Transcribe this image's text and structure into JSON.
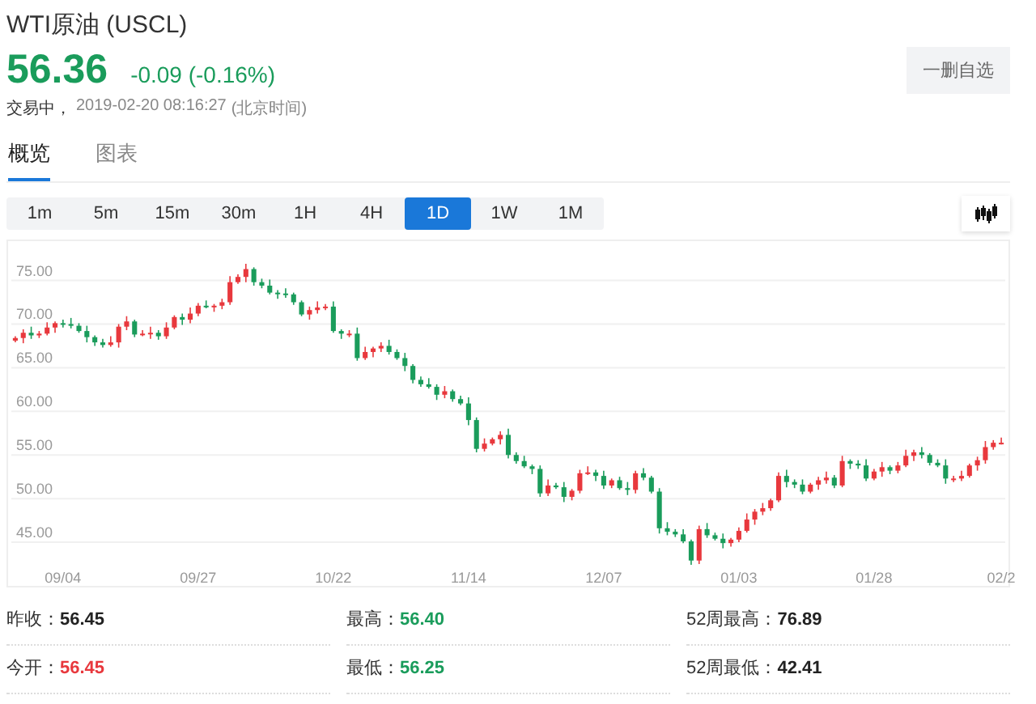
{
  "header": {
    "title": "WTI原油 (USCL)",
    "price": "56.36",
    "change": "-0.09 (-0.16%)",
    "status": "交易中，",
    "time": "2019-02-20 08:16:27",
    "timezone": "(北京时间)",
    "watch_button": "一删自选"
  },
  "tabs": [
    {
      "label": "概览",
      "selected": true
    },
    {
      "label": "图表",
      "selected": false
    }
  ],
  "periods": [
    {
      "label": "1m",
      "selected": false
    },
    {
      "label": "5m",
      "selected": false
    },
    {
      "label": "15m",
      "selected": false
    },
    {
      "label": "30m",
      "selected": false
    },
    {
      "label": "1H",
      "selected": false
    },
    {
      "label": "4H",
      "selected": false
    },
    {
      "label": "1D",
      "selected": true
    },
    {
      "label": "1W",
      "selected": false
    },
    {
      "label": "1M",
      "selected": false
    }
  ],
  "chart": {
    "chart_data": {
      "type": "candlestick",
      "categories": [
        null,
        null,
        null,
        null,
        null,
        null,
        "09/04",
        null,
        null,
        null,
        null,
        null,
        null,
        null,
        null,
        null,
        null,
        null,
        null,
        null,
        null,
        null,
        null,
        "09/27",
        null,
        null,
        null,
        null,
        null,
        null,
        null,
        null,
        null,
        null,
        null,
        null,
        null,
        null,
        null,
        null,
        "10/22",
        null,
        null,
        null,
        null,
        null,
        null,
        null,
        null,
        null,
        null,
        null,
        null,
        null,
        null,
        null,
        null,
        "11/14",
        null,
        null,
        null,
        null,
        null,
        null,
        null,
        null,
        null,
        null,
        null,
        null,
        null,
        null,
        null,
        null,
        "12/07",
        null,
        null,
        null,
        null,
        null,
        null,
        null,
        null,
        null,
        null,
        null,
        null,
        null,
        null,
        null,
        null,
        "01/03",
        null,
        null,
        null,
        null,
        null,
        null,
        null,
        null,
        null,
        null,
        null,
        null,
        null,
        null,
        null,
        null,
        "01/28",
        null,
        null,
        null,
        null,
        null,
        null,
        null,
        null,
        null,
        null,
        null,
        null,
        null,
        null,
        null,
        "02/2"
      ],
      "ohlc": [
        [
          68.1,
          68.6,
          67.9,
          68.4
        ],
        [
          68.4,
          69.4,
          67.8,
          69.0
        ],
        [
          69.0,
          69.7,
          68.3,
          68.7
        ],
        [
          68.7,
          69.2,
          68.4,
          68.9
        ],
        [
          68.9,
          70.2,
          68.7,
          69.6
        ],
        [
          69.6,
          70.3,
          69.0,
          70.1
        ],
        [
          70.1,
          70.5,
          69.6,
          70.0
        ],
        [
          70.0,
          70.7,
          69.5,
          69.8
        ],
        [
          69.8,
          70.1,
          69.0,
          69.2
        ],
        [
          69.2,
          69.8,
          67.9,
          68.5
        ],
        [
          68.5,
          68.7,
          67.5,
          67.9
        ],
        [
          67.9,
          68.3,
          67.3,
          67.6
        ],
        [
          67.6,
          68.6,
          67.4,
          67.9
        ],
        [
          67.9,
          70.0,
          67.3,
          69.7
        ],
        [
          69.7,
          70.9,
          69.3,
          70.3
        ],
        [
          70.3,
          70.5,
          68.5,
          68.8
        ],
        [
          68.8,
          69.3,
          68.6,
          68.9
        ],
        [
          68.9,
          69.7,
          68.3,
          69.0
        ],
        [
          69.0,
          69.3,
          68.2,
          68.6
        ],
        [
          68.6,
          70.2,
          68.3,
          69.6
        ],
        [
          69.6,
          71.0,
          69.4,
          70.8
        ],
        [
          70.8,
          71.2,
          69.9,
          70.5
        ],
        [
          70.5,
          71.9,
          70.1,
          71.2
        ],
        [
          71.2,
          72.4,
          70.9,
          72.1
        ],
        [
          72.1,
          72.7,
          71.8,
          72.0
        ],
        [
          72.0,
          72.3,
          71.4,
          72.1
        ],
        [
          72.1,
          72.9,
          71.7,
          72.5
        ],
        [
          72.5,
          75.5,
          72.2,
          74.8
        ],
        [
          74.8,
          75.7,
          74.6,
          75.4
        ],
        [
          75.4,
          76.9,
          74.8,
          76.3
        ],
        [
          76.3,
          76.5,
          74.4,
          74.8
        ],
        [
          74.8,
          75.2,
          74.1,
          74.4
        ],
        [
          74.4,
          75.1,
          73.4,
          73.6
        ],
        [
          73.6,
          73.9,
          72.9,
          73.5
        ],
        [
          73.5,
          74.1,
          73.0,
          73.4
        ],
        [
          73.4,
          73.6,
          72.2,
          72.5
        ],
        [
          72.5,
          72.7,
          70.9,
          71.1
        ],
        [
          71.1,
          72.0,
          70.5,
          71.6
        ],
        [
          71.6,
          72.6,
          71.2,
          71.9
        ],
        [
          71.9,
          72.3,
          71.6,
          72.0
        ],
        [
          72.0,
          72.6,
          69.0,
          69.2
        ],
        [
          69.2,
          69.4,
          68.3,
          68.9
        ],
        [
          68.9,
          69.3,
          68.5,
          68.9
        ],
        [
          68.9,
          69.6,
          65.8,
          66.1
        ],
        [
          66.1,
          67.4,
          65.9,
          66.8
        ],
        [
          66.8,
          67.4,
          66.2,
          67.2
        ],
        [
          67.2,
          67.9,
          66.8,
          67.5
        ],
        [
          67.5,
          68.2,
          66.5,
          66.8
        ],
        [
          66.8,
          67.1,
          65.9,
          66.1
        ],
        [
          66.1,
          66.7,
          64.6,
          65.2
        ],
        [
          65.2,
          65.4,
          63.2,
          63.6
        ],
        [
          63.6,
          64.0,
          62.8,
          63.1
        ],
        [
          63.1,
          63.8,
          62.6,
          62.8
        ],
        [
          62.8,
          63.1,
          61.3,
          61.9
        ],
        [
          61.9,
          62.9,
          61.5,
          62.3
        ],
        [
          62.3,
          62.5,
          61.1,
          61.4
        ],
        [
          61.4,
          61.8,
          60.7,
          60.9
        ],
        [
          60.9,
          61.6,
          58.4,
          59.0
        ],
        [
          59.0,
          59.3,
          55.3,
          55.7
        ],
        [
          55.7,
          56.9,
          55.4,
          56.3
        ],
        [
          56.3,
          57.0,
          56.1,
          56.8
        ],
        [
          56.8,
          57.7,
          56.2,
          57.3
        ],
        [
          57.3,
          58.0,
          54.6,
          55.0
        ],
        [
          55.0,
          55.3,
          54.0,
          54.3
        ],
        [
          54.3,
          54.9,
          53.5,
          53.7
        ],
        [
          53.7,
          53.9,
          52.8,
          53.4
        ],
        [
          53.4,
          53.8,
          50.2,
          50.6
        ],
        [
          50.6,
          52.2,
          50.3,
          51.5
        ],
        [
          51.5,
          51.8,
          51.1,
          51.3
        ],
        [
          51.3,
          51.9,
          49.6,
          50.2
        ],
        [
          50.2,
          51.1,
          49.8,
          50.9
        ],
        [
          50.9,
          53.3,
          50.6,
          52.9
        ],
        [
          52.9,
          53.7,
          52.7,
          53.0
        ],
        [
          53.0,
          53.3,
          52.0,
          52.6
        ],
        [
          52.6,
          53.2,
          51.1,
          51.5
        ],
        [
          51.5,
          52.3,
          51.2,
          52.1
        ],
        [
          52.1,
          52.5,
          51.0,
          51.2
        ],
        [
          51.2,
          51.9,
          50.4,
          51.0
        ],
        [
          51.0,
          53.2,
          50.6,
          52.9
        ],
        [
          52.9,
          53.5,
          52.1,
          52.4
        ],
        [
          52.4,
          52.6,
          50.6,
          50.8
        ],
        [
          50.8,
          51.2,
          46.0,
          46.6
        ],
        [
          46.6,
          47.3,
          45.8,
          46.2
        ],
        [
          46.2,
          46.5,
          45.6,
          45.9
        ],
        [
          45.9,
          46.5,
          44.9,
          45.1
        ],
        [
          45.1,
          45.3,
          42.4,
          42.9
        ],
        [
          42.9,
          46.9,
          42.5,
          46.5
        ],
        [
          46.5,
          47.2,
          45.5,
          45.8
        ],
        [
          45.8,
          46.1,
          45.2,
          45.4
        ],
        [
          45.4,
          46.0,
          44.3,
          44.9
        ],
        [
          44.9,
          45.5,
          44.5,
          45.3
        ],
        [
          45.3,
          46.7,
          45.0,
          46.3
        ],
        [
          46.3,
          48.3,
          46.1,
          47.6
        ],
        [
          47.6,
          48.8,
          47.0,
          48.5
        ],
        [
          48.5,
          49.5,
          48.1,
          48.9
        ],
        [
          48.9,
          50.0,
          48.6,
          49.8
        ],
        [
          49.8,
          53.0,
          49.6,
          52.6
        ],
        [
          52.6,
          53.3,
          51.3,
          51.9
        ],
        [
          51.9,
          52.2,
          51.2,
          51.6
        ],
        [
          51.6,
          52.2,
          50.5,
          50.8
        ],
        [
          50.8,
          51.8,
          50.6,
          51.6
        ],
        [
          51.6,
          52.5,
          51.0,
          52.1
        ],
        [
          52.1,
          53.1,
          51.7,
          52.4
        ],
        [
          52.4,
          52.7,
          51.2,
          51.5
        ],
        [
          51.5,
          54.9,
          51.3,
          54.3
        ],
        [
          54.3,
          54.5,
          53.4,
          54.0
        ],
        [
          54.0,
          54.4,
          53.4,
          53.8
        ],
        [
          53.8,
          54.5,
          52.0,
          52.3
        ],
        [
          52.3,
          53.4,
          52.1,
          53.1
        ],
        [
          53.1,
          54.2,
          52.5,
          53.6
        ],
        [
          53.6,
          53.8,
          52.8,
          53.2
        ],
        [
          53.2,
          54.2,
          52.9,
          53.8
        ],
        [
          53.8,
          55.6,
          53.6,
          54.9
        ],
        [
          54.9,
          55.6,
          54.3,
          55.3
        ],
        [
          55.3,
          55.9,
          54.6,
          55.0
        ],
        [
          55.0,
          55.2,
          53.8,
          54.1
        ],
        [
          54.1,
          54.5,
          53.6,
          53.8
        ],
        [
          53.8,
          54.5,
          51.7,
          52.3
        ],
        [
          52.3,
          52.6,
          51.9,
          52.3
        ],
        [
          52.3,
          53.2,
          52.0,
          52.6
        ],
        [
          52.6,
          54.0,
          52.4,
          53.8
        ],
        [
          53.8,
          54.8,
          53.2,
          54.4
        ],
        [
          54.4,
          56.6,
          54.0,
          55.9
        ],
        [
          55.9,
          56.7,
          55.6,
          56.4
        ],
        [
          56.4,
          57.0,
          56.2,
          56.4
        ]
      ],
      "ylim": [
        40.0,
        79.5
      ],
      "grid": true,
      "yticks": [
        {
          "value": 45,
          "label": "45.00"
        },
        {
          "value": 50,
          "label": "50.00"
        },
        {
          "value": 55,
          "label": "55.00"
        },
        {
          "value": 60,
          "label": "60.00"
        },
        {
          "value": 65,
          "label": "65.00"
        },
        {
          "value": 70,
          "label": "70.00"
        },
        {
          "value": 75,
          "label": "75.00"
        }
      ]
    }
  },
  "stats": [
    {
      "label": "昨收：",
      "value": "56.45",
      "color": "#222222"
    },
    {
      "label": "最高：",
      "value": "56.40",
      "color": "#1a9c5b"
    },
    {
      "label": "52周最高：",
      "value": "76.89",
      "color": "#222222"
    },
    {
      "label": "今开：",
      "value": "56.45",
      "color": "#e8383d"
    },
    {
      "label": "最低：",
      "value": "56.25",
      "color": "#1a9c5b"
    },
    {
      "label": "52周最低：",
      "value": "42.41",
      "color": "#222222"
    }
  ]
}
